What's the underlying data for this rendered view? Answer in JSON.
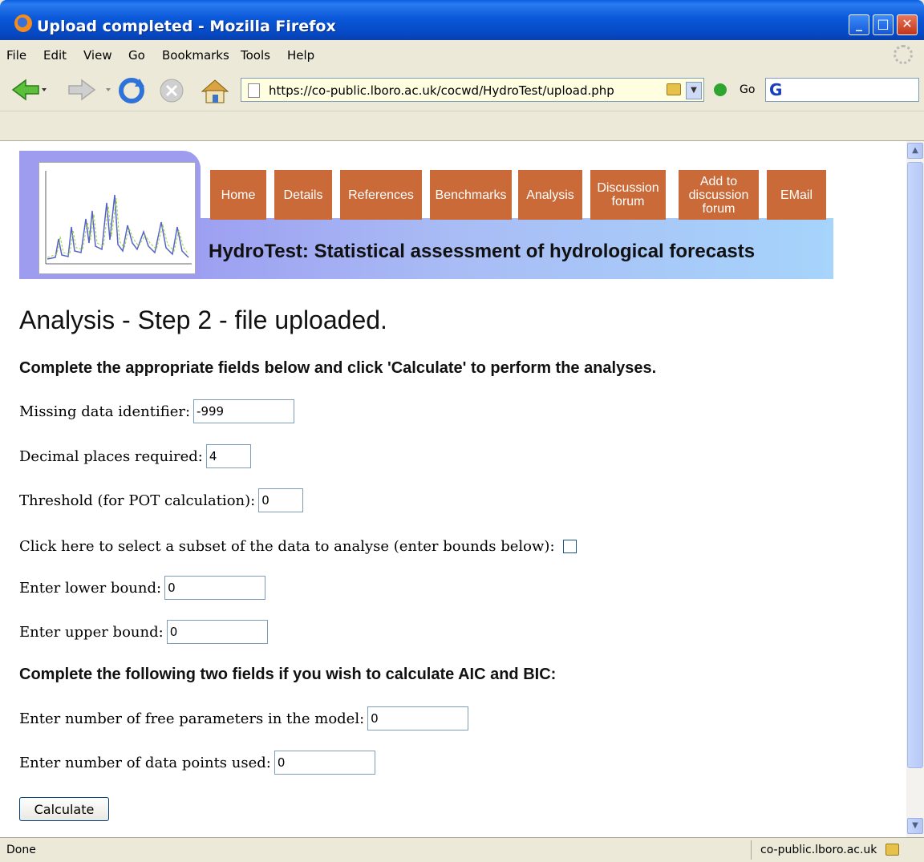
{
  "window": {
    "title": "Upload completed - Mozilla Firefox"
  },
  "menu": [
    "File",
    "Edit",
    "View",
    "Go",
    "Bookmarks",
    "Tools",
    "Help"
  ],
  "toolbar": {
    "url": "https://co-public.lboro.ac.uk/cocwd/HydroTest/upload.php",
    "go_label": "Go",
    "search_logo": "G"
  },
  "icons": [
    "back-icon",
    "forward-icon",
    "reload-icon",
    "stop-icon",
    "home-icon",
    "page-icon",
    "lock-icon",
    "go-icon",
    "google-icon"
  ],
  "banner": {
    "nav": [
      "Home",
      "Details",
      "References",
      "Benchmarks",
      "Analysis",
      "Discussion forum",
      "Add to discussion forum",
      "EMail"
    ],
    "title": "HydroTest: Statistical assessment of hydrological forecasts",
    "nav_color": "#c96a38"
  },
  "page": {
    "heading": "Analysis - Step 2 - file uploaded.",
    "intro": "Complete the appropriate fields below and click 'Calculate' to perform the analyses.",
    "missing_label": "Missing data identifier:",
    "missing_value": "-999",
    "decimal_label": "Decimal places required:",
    "decimal_value": "4",
    "threshold_label": "Threshold (for POT calculation):",
    "threshold_value": "0",
    "subset_label": "Click here to select a subset of the data to analyse (enter bounds below):",
    "lower_label": "Enter lower bound:",
    "lower_value": "0",
    "upper_label": "Enter upper bound:",
    "upper_value": "0",
    "aic_heading": "Complete the following two fields if you wish to calculate AIC and BIC:",
    "params_label": "Enter number of free parameters in the model:",
    "params_value": "0",
    "points_label": "Enter number of data points used:",
    "points_value": "0",
    "calculate_label": "Calculate"
  },
  "status": {
    "left": "Done",
    "host": "co-public.lboro.ac.uk"
  }
}
